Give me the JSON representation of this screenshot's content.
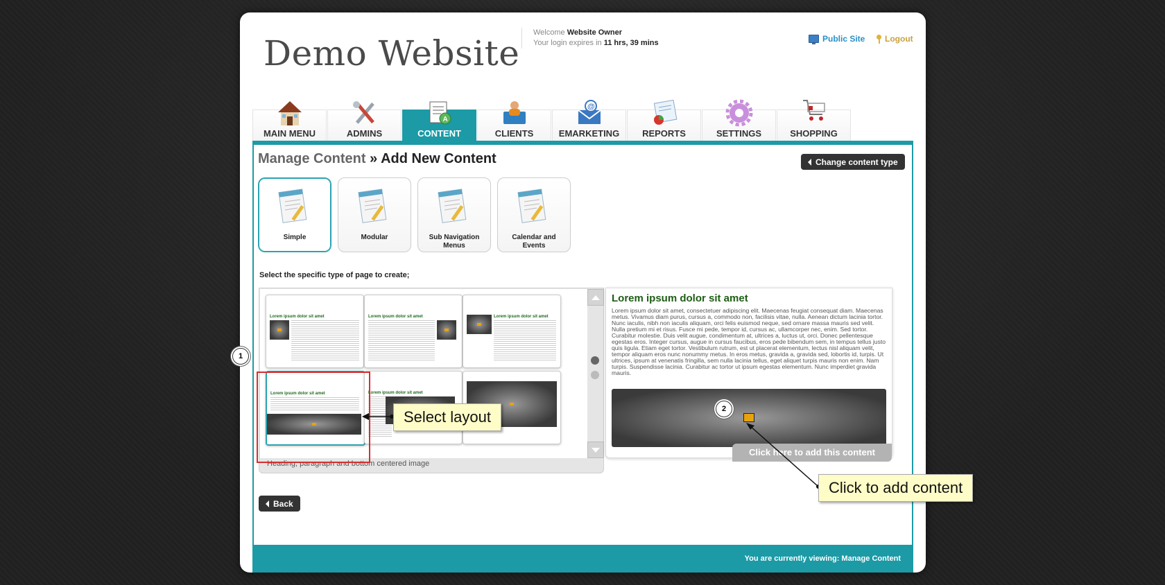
{
  "header": {
    "site_title": "Demo Website",
    "welcome_label": "Welcome",
    "user_name": "Website Owner",
    "expires_prefix": "Your login expires in",
    "expires_value": "11 hrs, 39 mins",
    "public_site": "Public Site",
    "logout": "Logout"
  },
  "nav": {
    "tabs": [
      {
        "label": "MAIN MENU",
        "icon": "house-icon"
      },
      {
        "label": "ADMINS",
        "icon": "tools-icon"
      },
      {
        "label": "CONTENT",
        "icon": "document-icon",
        "active": true
      },
      {
        "label": "CLIENTS",
        "icon": "person-folder-icon"
      },
      {
        "label": "EMARKETING",
        "icon": "email-icon"
      },
      {
        "label": "REPORTS",
        "icon": "report-chart-icon"
      },
      {
        "label": "SETTINGS",
        "icon": "gear-icon"
      },
      {
        "label": "SHOPPING",
        "icon": "cart-icon"
      }
    ]
  },
  "main": {
    "breadcrumb_parent": "Manage Content",
    "breadcrumb_separator": " » ",
    "title": "Add New Content",
    "change_type_button": "Change content type",
    "content_types": [
      {
        "label": "Simple",
        "selected": true
      },
      {
        "label": "Modular"
      },
      {
        "label": "Sub Navigation Menus"
      },
      {
        "label": "Calendar and Events"
      }
    ],
    "select_prompt": "Select the specific type of page to create;",
    "layout_thumb_heading": "Lorem ipsum dolor sit amet",
    "layout_caption": "Heading, paragraph and bottom centered image",
    "back_button": "Back"
  },
  "preview": {
    "heading": "Lorem ipsum dolor sit amet",
    "body": "Lorem ipsum dolor sit amet, consectetuer adipiscing elit. Maecenas feugiat consequat diam. Maecenas metus. Vivamus diam purus, cursus a, commodo non, facilisis vitae, nulla. Aenean dictum lacinia tortor. Nunc iaculis, nibh non iaculis aliquam, orci felis euismod neque, sed ornare massa mauris sed velit. Nulla pretium mi et risus. Fusce mi pede, tempor id, cursus ac, ullamcorper nec, enim. Sed tortor. Curabitur molestie. Duis velit augue, condimentum at, ultrices a, luctus ut, orci. Donec pellentesque egestas eros. Integer cursus, augue in cursus faucibus, eros pede bibendum sem, in tempus tellus justo quis ligula. Etiam eget tortor. Vestibulum rutrum, est ut placerat elementum, lectus nisl aliquam velit, tempor aliquam eros nunc nonummy metus. In eros metus, gravida a, gravida sed, lobortis id, turpis. Ut ultrices, ipsum at venenatis fringilla, sem nulla lacinia tellus, eget aliquet turpis mauris non enim. Nam turpis. Suspendisse lacinia. Curabitur ac tortor ut ipsum egestas elementum. Nunc imperdiet gravida mauris.",
    "add_button": "Click here to add this content"
  },
  "footer": {
    "viewing": "You are currently viewing: Manage Content"
  },
  "annotations": {
    "marker_1": "1",
    "marker_2": "2",
    "select_layout": "Select layout",
    "click_to_add": "Click to add content"
  },
  "colors": {
    "accent": "#1c9aa6",
    "heading_green": "#1e5d14",
    "callout_bg": "#fefcc7",
    "highlight_red": "#d23030"
  }
}
